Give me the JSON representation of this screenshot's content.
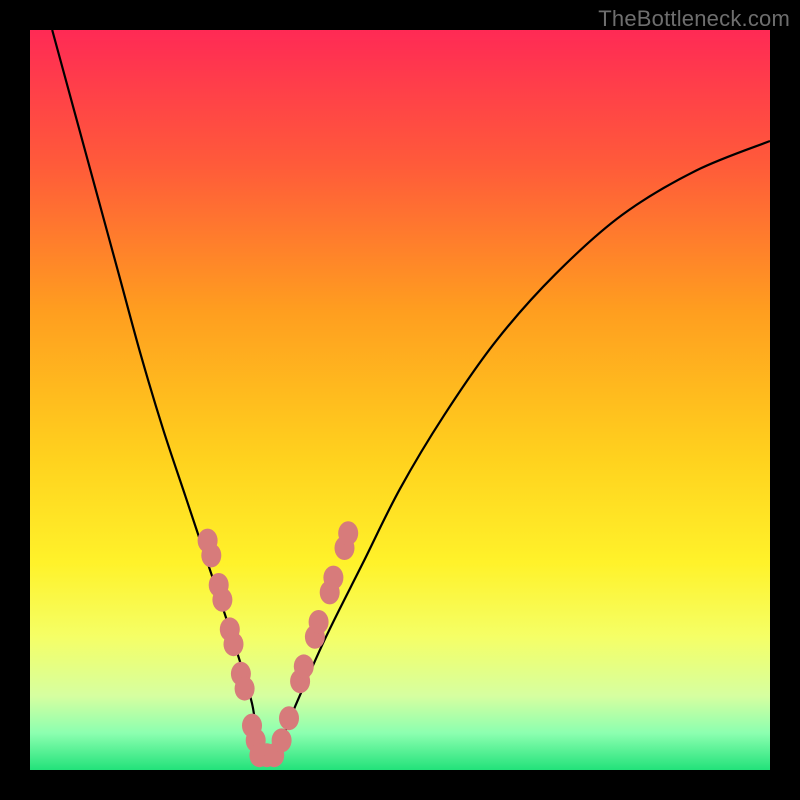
{
  "watermark": "TheBottleneck.com",
  "colors": {
    "frame": "#000000",
    "curve": "#000000",
    "markers_fill": "#d77b7b",
    "markers_stroke": "#c55e5e",
    "gradient_stops": [
      {
        "at": 0.0,
        "hex": "#ff2a55"
      },
      {
        "at": 0.18,
        "hex": "#ff5a3a"
      },
      {
        "at": 0.38,
        "hex": "#ff9e1f"
      },
      {
        "at": 0.58,
        "hex": "#ffd21e"
      },
      {
        "at": 0.72,
        "hex": "#fff22a"
      },
      {
        "at": 0.82,
        "hex": "#f5ff66"
      },
      {
        "at": 0.9,
        "hex": "#d6ffa0"
      },
      {
        "at": 0.95,
        "hex": "#8cffb0"
      },
      {
        "at": 1.0,
        "hex": "#22e27a"
      }
    ]
  },
  "chart_data": {
    "type": "line",
    "title": "",
    "xlabel": "",
    "ylabel": "",
    "xlim": [
      0,
      100
    ],
    "ylim": [
      0,
      100
    ],
    "note": "V-shaped bottleneck curve; x is an unlabeled component-score axis, y is bottleneck magnitude (0 = optimal, 100 = worst). Values read approximately from the plot.",
    "series": [
      {
        "name": "bottleneck-curve",
        "x": [
          3,
          6,
          9,
          12,
          15,
          18,
          21,
          24,
          27,
          30,
          31,
          33,
          36,
          40,
          45,
          50,
          56,
          63,
          71,
          80,
          90,
          100
        ],
        "y": [
          100,
          89,
          78,
          67,
          56,
          46,
          37,
          28,
          19,
          9,
          2,
          2,
          9,
          18,
          28,
          38,
          48,
          58,
          67,
          75,
          81,
          85
        ]
      }
    ],
    "markers": {
      "name": "highlighted-points",
      "comment": "salmon beads clustered near the trough on both arms",
      "points": [
        {
          "x": 24.0,
          "y": 31
        },
        {
          "x": 24.5,
          "y": 29
        },
        {
          "x": 25.5,
          "y": 25
        },
        {
          "x": 26.0,
          "y": 23
        },
        {
          "x": 27.0,
          "y": 19
        },
        {
          "x": 27.5,
          "y": 17
        },
        {
          "x": 28.5,
          "y": 13
        },
        {
          "x": 29.0,
          "y": 11
        },
        {
          "x": 30.0,
          "y": 6
        },
        {
          "x": 30.5,
          "y": 4
        },
        {
          "x": 31.0,
          "y": 2
        },
        {
          "x": 32.0,
          "y": 2
        },
        {
          "x": 33.0,
          "y": 2
        },
        {
          "x": 34.0,
          "y": 4
        },
        {
          "x": 35.0,
          "y": 7
        },
        {
          "x": 36.5,
          "y": 12
        },
        {
          "x": 37.0,
          "y": 14
        },
        {
          "x": 38.5,
          "y": 18
        },
        {
          "x": 39.0,
          "y": 20
        },
        {
          "x": 40.5,
          "y": 24
        },
        {
          "x": 41.0,
          "y": 26
        },
        {
          "x": 42.5,
          "y": 30
        },
        {
          "x": 43.0,
          "y": 32
        }
      ]
    }
  }
}
